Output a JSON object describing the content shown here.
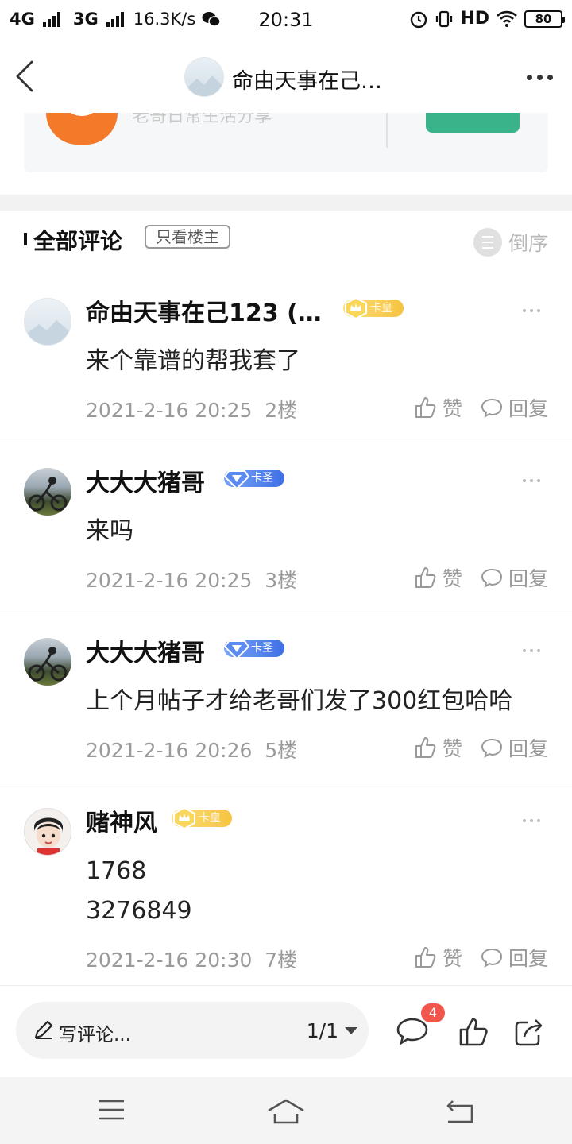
{
  "status_bar": {
    "network_1": "4G",
    "network_2": "3G",
    "speed": "16.3K/s",
    "time": "20:31",
    "hd": "HD",
    "battery": "80"
  },
  "header": {
    "title": "命由天事在己…"
  },
  "forum_card": {
    "description": "老哥日常生活分享"
  },
  "comments_section": {
    "title": "全部评论",
    "only_owner_label": "只看楼主",
    "sort_label": "倒序"
  },
  "comments": [
    {
      "name": "命由天事在己123 (…",
      "badge": "卡皇",
      "text_lines": [
        "来个靠谱的帮我套了"
      ],
      "time": "2021-2-16 20:25",
      "floor": "2楼",
      "like_label": "赞",
      "reply_label": "回复"
    },
    {
      "name": "大大大猪哥",
      "badge": "卡圣",
      "text_lines": [
        "来吗"
      ],
      "time": "2021-2-16 20:25",
      "floor": "3楼",
      "like_label": "赞",
      "reply_label": "回复"
    },
    {
      "name": "大大大猪哥",
      "badge": "卡圣",
      "text_lines": [
        "上个月帖子才给老哥们发了300红包哈哈"
      ],
      "time": "2021-2-16 20:26",
      "floor": "5楼",
      "like_label": "赞",
      "reply_label": "回复"
    },
    {
      "name": "赌神风",
      "badge": "卡皇",
      "text_lines": [
        "1768",
        "3276849"
      ],
      "time": "2021-2-16 20:30",
      "floor": "7楼",
      "like_label": "赞",
      "reply_label": "回复"
    }
  ],
  "bottom_bar": {
    "comment_placeholder": "写评论...",
    "page_indicator": "1/1",
    "comment_count": "4"
  },
  "colors": {
    "accent_green": "#3ab38a",
    "badge_red": "#f2554c",
    "gold_badge": "#f6c340",
    "blue_badge": "#3f6fe6",
    "forum_logo": "#f47a2a"
  },
  "icons": [
    "back-arrow-icon",
    "more-icon",
    "sort-icon",
    "like-icon",
    "reply-icon",
    "pen-icon",
    "comment-icon",
    "share-icon",
    "menu-icon",
    "home-icon",
    "return-icon"
  ]
}
